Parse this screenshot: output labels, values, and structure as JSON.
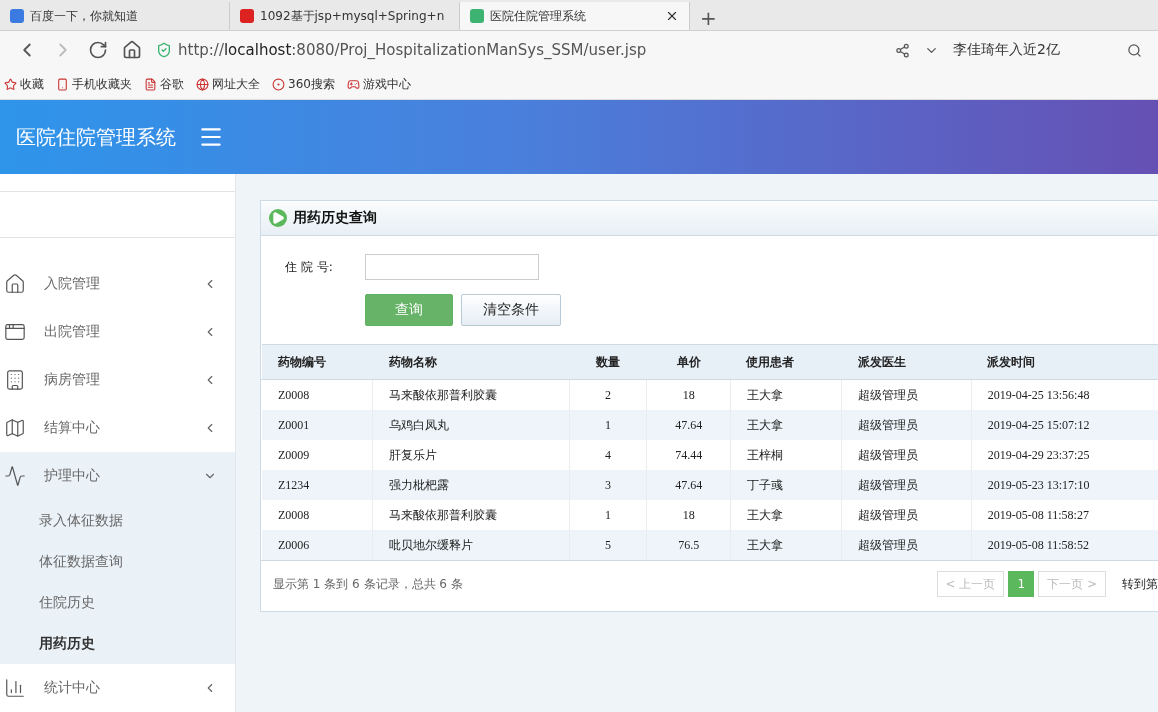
{
  "browser": {
    "tabs": [
      {
        "title": "百度一下，你就知道",
        "selected": false,
        "closable": false
      },
      {
        "title": "1092基于jsp+mysql+Spring+n",
        "selected": false,
        "closable": false
      },
      {
        "title": "医院住院管理系统",
        "selected": true,
        "closable": true
      }
    ],
    "new_tab": "+",
    "url": {
      "scheme": "http://",
      "host": "localhost",
      "rest": ":8080/Proj_HospitalizationManSys_SSM/user.jsp"
    },
    "search_text": "李佳琦年入近2亿",
    "bookmarks": [
      {
        "label": "收藏",
        "kind": "star"
      },
      {
        "label": "手机收藏夹",
        "kind": "phone"
      },
      {
        "label": "谷歌",
        "kind": "page"
      },
      {
        "label": "网址大全",
        "kind": "globe"
      },
      {
        "label": "360搜索",
        "kind": "ring"
      },
      {
        "label": "游戏中心",
        "kind": "game"
      }
    ]
  },
  "app": {
    "title": "医院住院管理系统"
  },
  "sidebar": {
    "items": [
      {
        "label": "入院管理",
        "expanded": false
      },
      {
        "label": "出院管理",
        "expanded": false
      },
      {
        "label": "病房管理",
        "expanded": false
      },
      {
        "label": "结算中心",
        "expanded": false
      },
      {
        "label": "护理中心",
        "expanded": true,
        "children": [
          {
            "label": "录入体征数据",
            "selected": false
          },
          {
            "label": "体征数据查询",
            "selected": false
          },
          {
            "label": "住院历史",
            "selected": false
          },
          {
            "label": "用药历史",
            "selected": true
          }
        ]
      },
      {
        "label": "统计中心",
        "expanded": false
      }
    ]
  },
  "panel": {
    "title": "用药历史查询",
    "form": {
      "label": "住 院 号:",
      "buttons": [
        {
          "label": "查询",
          "kind": "primary"
        },
        {
          "label": "清空条件",
          "kind": "default"
        }
      ]
    },
    "table": {
      "columns": [
        "药物编号",
        "药物名称",
        "数量",
        "单价",
        "使用患者",
        "派发医生",
        "派发时间"
      ],
      "rows": [
        [
          "Z0008",
          "马来酸依那普利胶囊",
          "2",
          "18",
          "王大拿",
          "超级管理员",
          "2019-04-25 13:56:48"
        ],
        [
          "Z0001",
          "乌鸡白凤丸",
          "1",
          "47.64",
          "王大拿",
          "超级管理员",
          "2019-04-25 15:07:12"
        ],
        [
          "Z0009",
          "肝复乐片",
          "4",
          "74.44",
          "王梓桐",
          "超级管理员",
          "2019-04-29 23:37:25"
        ],
        [
          "Z1234",
          "强力枇杷露",
          "3",
          "47.64",
          "丁子彧",
          "超级管理员",
          "2019-05-23 13:17:10"
        ],
        [
          "Z0008",
          "马来酸依那普利胶囊",
          "1",
          "18",
          "王大拿",
          "超级管理员",
          "2019-05-08 11:58:27"
        ],
        [
          "Z0006",
          "吡贝地尔缓释片",
          "5",
          "76.5",
          "王大拿",
          "超级管理员",
          "2019-05-08 11:58:52"
        ]
      ]
    },
    "summary": "显示第 1 条到 6 条记录，总共 6 条",
    "pager": [
      {
        "label": "< 上一页",
        "disabled": true,
        "selected": false
      },
      {
        "label": "1",
        "disabled": false,
        "selected": true
      },
      {
        "label": "下一页 >",
        "disabled": true,
        "selected": false
      }
    ],
    "goto": "转到第"
  }
}
